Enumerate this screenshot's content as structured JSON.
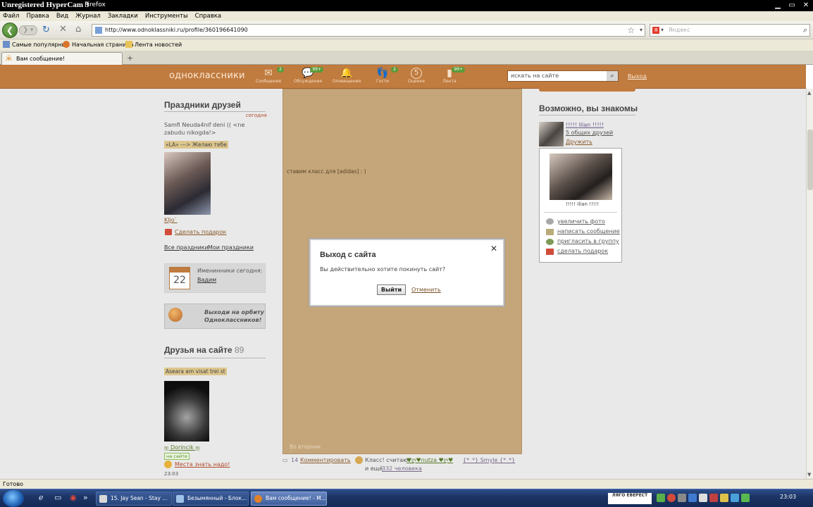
{
  "titlebar": {
    "app": "Unregistered HyperCam 3",
    "browser": "Firefox"
  },
  "menu": [
    "Файл",
    "Правка",
    "Вид",
    "Журнал",
    "Закладки",
    "Инструменты",
    "Справка"
  ],
  "nav": {
    "url": "http://www.odnoklassniki.ru/profile/360196641090",
    "search_placeholder": "Яндекс"
  },
  "bookmarks": [
    "Самые популярные",
    "Начальная страница",
    "Лента новостей"
  ],
  "tab": {
    "label": "Вам сообщение!"
  },
  "site": {
    "logo": "одноклассники",
    "nav": [
      {
        "label": "Сообщения",
        "badge": "2"
      },
      {
        "label": "Обсуждения",
        "badge": "99+"
      },
      {
        "label": "Оповещения",
        "badge": ""
      },
      {
        "label": "Гости",
        "badge": "2"
      },
      {
        "label": "Оценки",
        "badge": ""
      },
      {
        "label": "Лента",
        "badge": "99+"
      }
    ],
    "rating_num": "5",
    "search_placeholder": "искать на сайте",
    "logout": "Выход"
  },
  "left": {
    "holidays_title": "Праздники друзей",
    "today": "сегодня",
    "holiday_text": "Samfi Neuda4nif deni (( <ne zabudu nikogda!>",
    "friend_tag": "«LA» ---> Желаю тебе",
    "friend_name": "Kljo`",
    "gift_link": "Сделать подарок",
    "all_holidays": "Все праздники",
    "my_holidays": "Мои праздники",
    "birthdays_label": "Именинники сегодня:",
    "birthday_name": "Вадим",
    "calendar_day": "22",
    "promo_text": "Выходи на орбиту Одноклассников!",
    "friends_online_title": "Друзья на сайте",
    "friends_online_count": "89",
    "friend2_tag": "Aseara am visat trei st",
    "friend2_name": "ஐ Dorincik ஐ",
    "online_label": "на сайте",
    "status_link": "Места знать надо!",
    "time": "23:03"
  },
  "center": {
    "post_text": "ставим класс для [adidas] : )",
    "bottom_text": "Во вторник",
    "comments_count": "14",
    "comment_link": "Комментировать",
    "klass_text": "Класс! считают",
    "klass_user1": "♥ღ♥nutza ♥ღ♥",
    "klass_user2": "{*_*} Smyle {*_*}",
    "and_more": "и ещё",
    "more_people": "332 человека"
  },
  "right": {
    "title": "Возможно, вы знакомы",
    "person_name": "!!!!! Ilian !!!!!",
    "mutual": "5 общих друзей",
    "add_friend": "Дружить",
    "card_name": "!!!!! Ilian !!!!!",
    "actions": [
      "увеличить фото",
      "написать сообщение",
      "пригласить в группу",
      "сделать подарок"
    ]
  },
  "dialog": {
    "title": "Выход с сайта",
    "message": "Вы действительно хотите покинуть сайт?",
    "ok": "Выйти",
    "cancel": "Отменить"
  },
  "status": "Готово",
  "taskbar": {
    "tasks": [
      "15. Jay Sean - Stay ...",
      "Безымянный - Блок...",
      "Вам сообщение! - M..."
    ],
    "tray_logo": "ЛЯГО ЕВЕРЕСТ",
    "clock": "23:03"
  }
}
